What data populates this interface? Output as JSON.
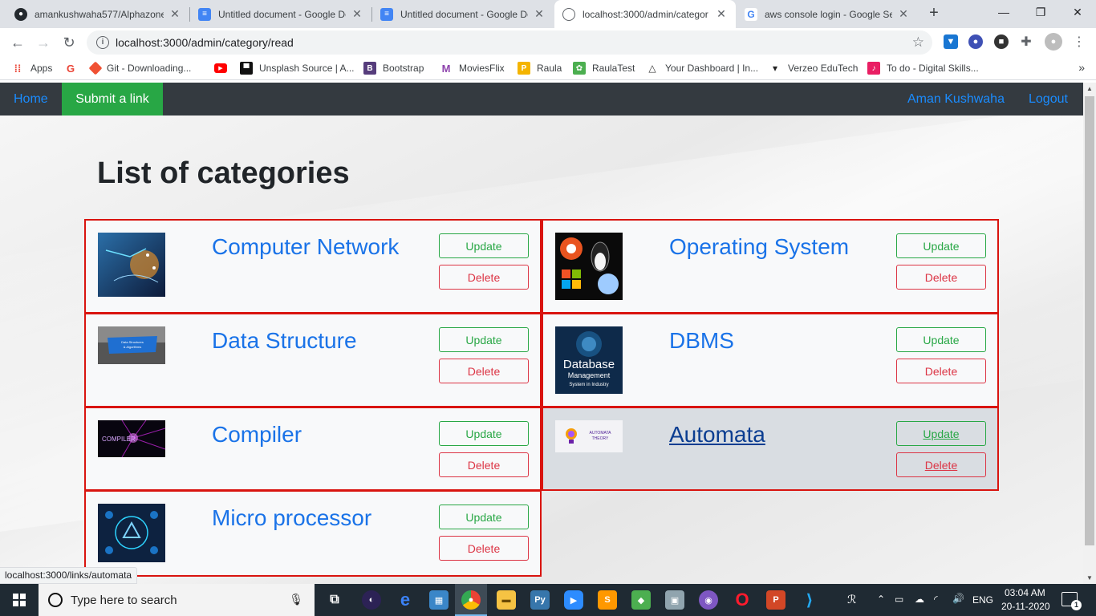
{
  "browser": {
    "tabs": [
      {
        "title": "amankushwaha577/Alphazone",
        "icon": "github-icon"
      },
      {
        "title": "Untitled document - Google Do",
        "icon": "google-docs-icon"
      },
      {
        "title": "Untitled document - Google Do",
        "icon": "google-docs-icon"
      },
      {
        "title": "localhost:3000/admin/categor",
        "icon": "globe-icon",
        "active": true
      },
      {
        "title": "aws console login - Google Se",
        "icon": "google-icon"
      }
    ],
    "new_tab": "+",
    "window_controls": {
      "minimize": "—",
      "maximize": "❐",
      "close": "✕"
    },
    "url": "localhost:3000/admin/category/read",
    "bookmarks": [
      {
        "label": "Apps",
        "icon": "apps-grid-icon",
        "color": "#4285f4"
      },
      {
        "label": "",
        "icon": "google-icon",
        "color": "#ffffff"
      },
      {
        "label": "Git - Downloading...",
        "icon": "git-icon",
        "color": "#f05133"
      },
      {
        "label": "",
        "icon": "youtube-icon",
        "color": "#ff0000"
      },
      {
        "label": "Unsplash Source | A...",
        "icon": "unsplash-icon",
        "color": "#111111"
      },
      {
        "label": "Bootstrap",
        "icon": "bootstrap-icon",
        "color": "#563d7c"
      },
      {
        "label": "MoviesFlix",
        "icon": "moviesflix-icon",
        "color": "#8e44ad"
      },
      {
        "label": "Raula",
        "icon": "raula-icon",
        "color": "#f4b400"
      },
      {
        "label": "RaulaTest",
        "icon": "raulatest-icon",
        "color": "#4caf50"
      },
      {
        "label": "Your Dashboard | In...",
        "icon": "dashboard-icon",
        "color": "#333333"
      },
      {
        "label": "Verzeo EduTech",
        "icon": "verzeo-icon",
        "color": "#222222"
      },
      {
        "label": "To do - Digital Skills...",
        "icon": "todo-icon",
        "color": "#e91e63"
      }
    ],
    "bookmarks_more": "»",
    "status_url": "localhost:3000/links/automata"
  },
  "navbar": {
    "home": "Home",
    "submit": "Submit a link",
    "user": "Aman Kushwaha",
    "logout": "Logout"
  },
  "heading": "List of categories",
  "buttons": {
    "update": "Update",
    "delete": "Delete"
  },
  "categories": [
    {
      "name": "Computer Network",
      "image": "computer-network-thumbnail"
    },
    {
      "name": "Operating System",
      "image": "operating-system-thumbnail"
    },
    {
      "name": "Data Structure",
      "image": "data-structure-thumbnail",
      "image_text": "Data Structures & Algorithms"
    },
    {
      "name": "DBMS",
      "image": "dbms-thumbnail",
      "image_text": [
        "Database",
        "Management",
        "System in Industry"
      ]
    },
    {
      "name": "Compiler",
      "image": "compiler-thumbnail",
      "image_text": "COMPILER"
    },
    {
      "name": "Automata",
      "image": "automata-thumbnail",
      "image_text": [
        "AUTOMATA",
        "THEORY"
      ],
      "hovered": true
    },
    {
      "name": "Micro processor",
      "image": "micro-processor-thumbnail"
    }
  ],
  "taskbar": {
    "search_placeholder": "Type here to search",
    "language": "ENG",
    "time": "03:04 AM",
    "date": "20-11-2020",
    "notifications": "1"
  },
  "colors": {
    "navbar_bg": "#343a40",
    "nav_link": "#1a8cff",
    "submit_bg": "#28a745",
    "card_border": "#d9140f",
    "update": "#28a745",
    "delete": "#dc3545",
    "category_link": "#1a73e8"
  }
}
